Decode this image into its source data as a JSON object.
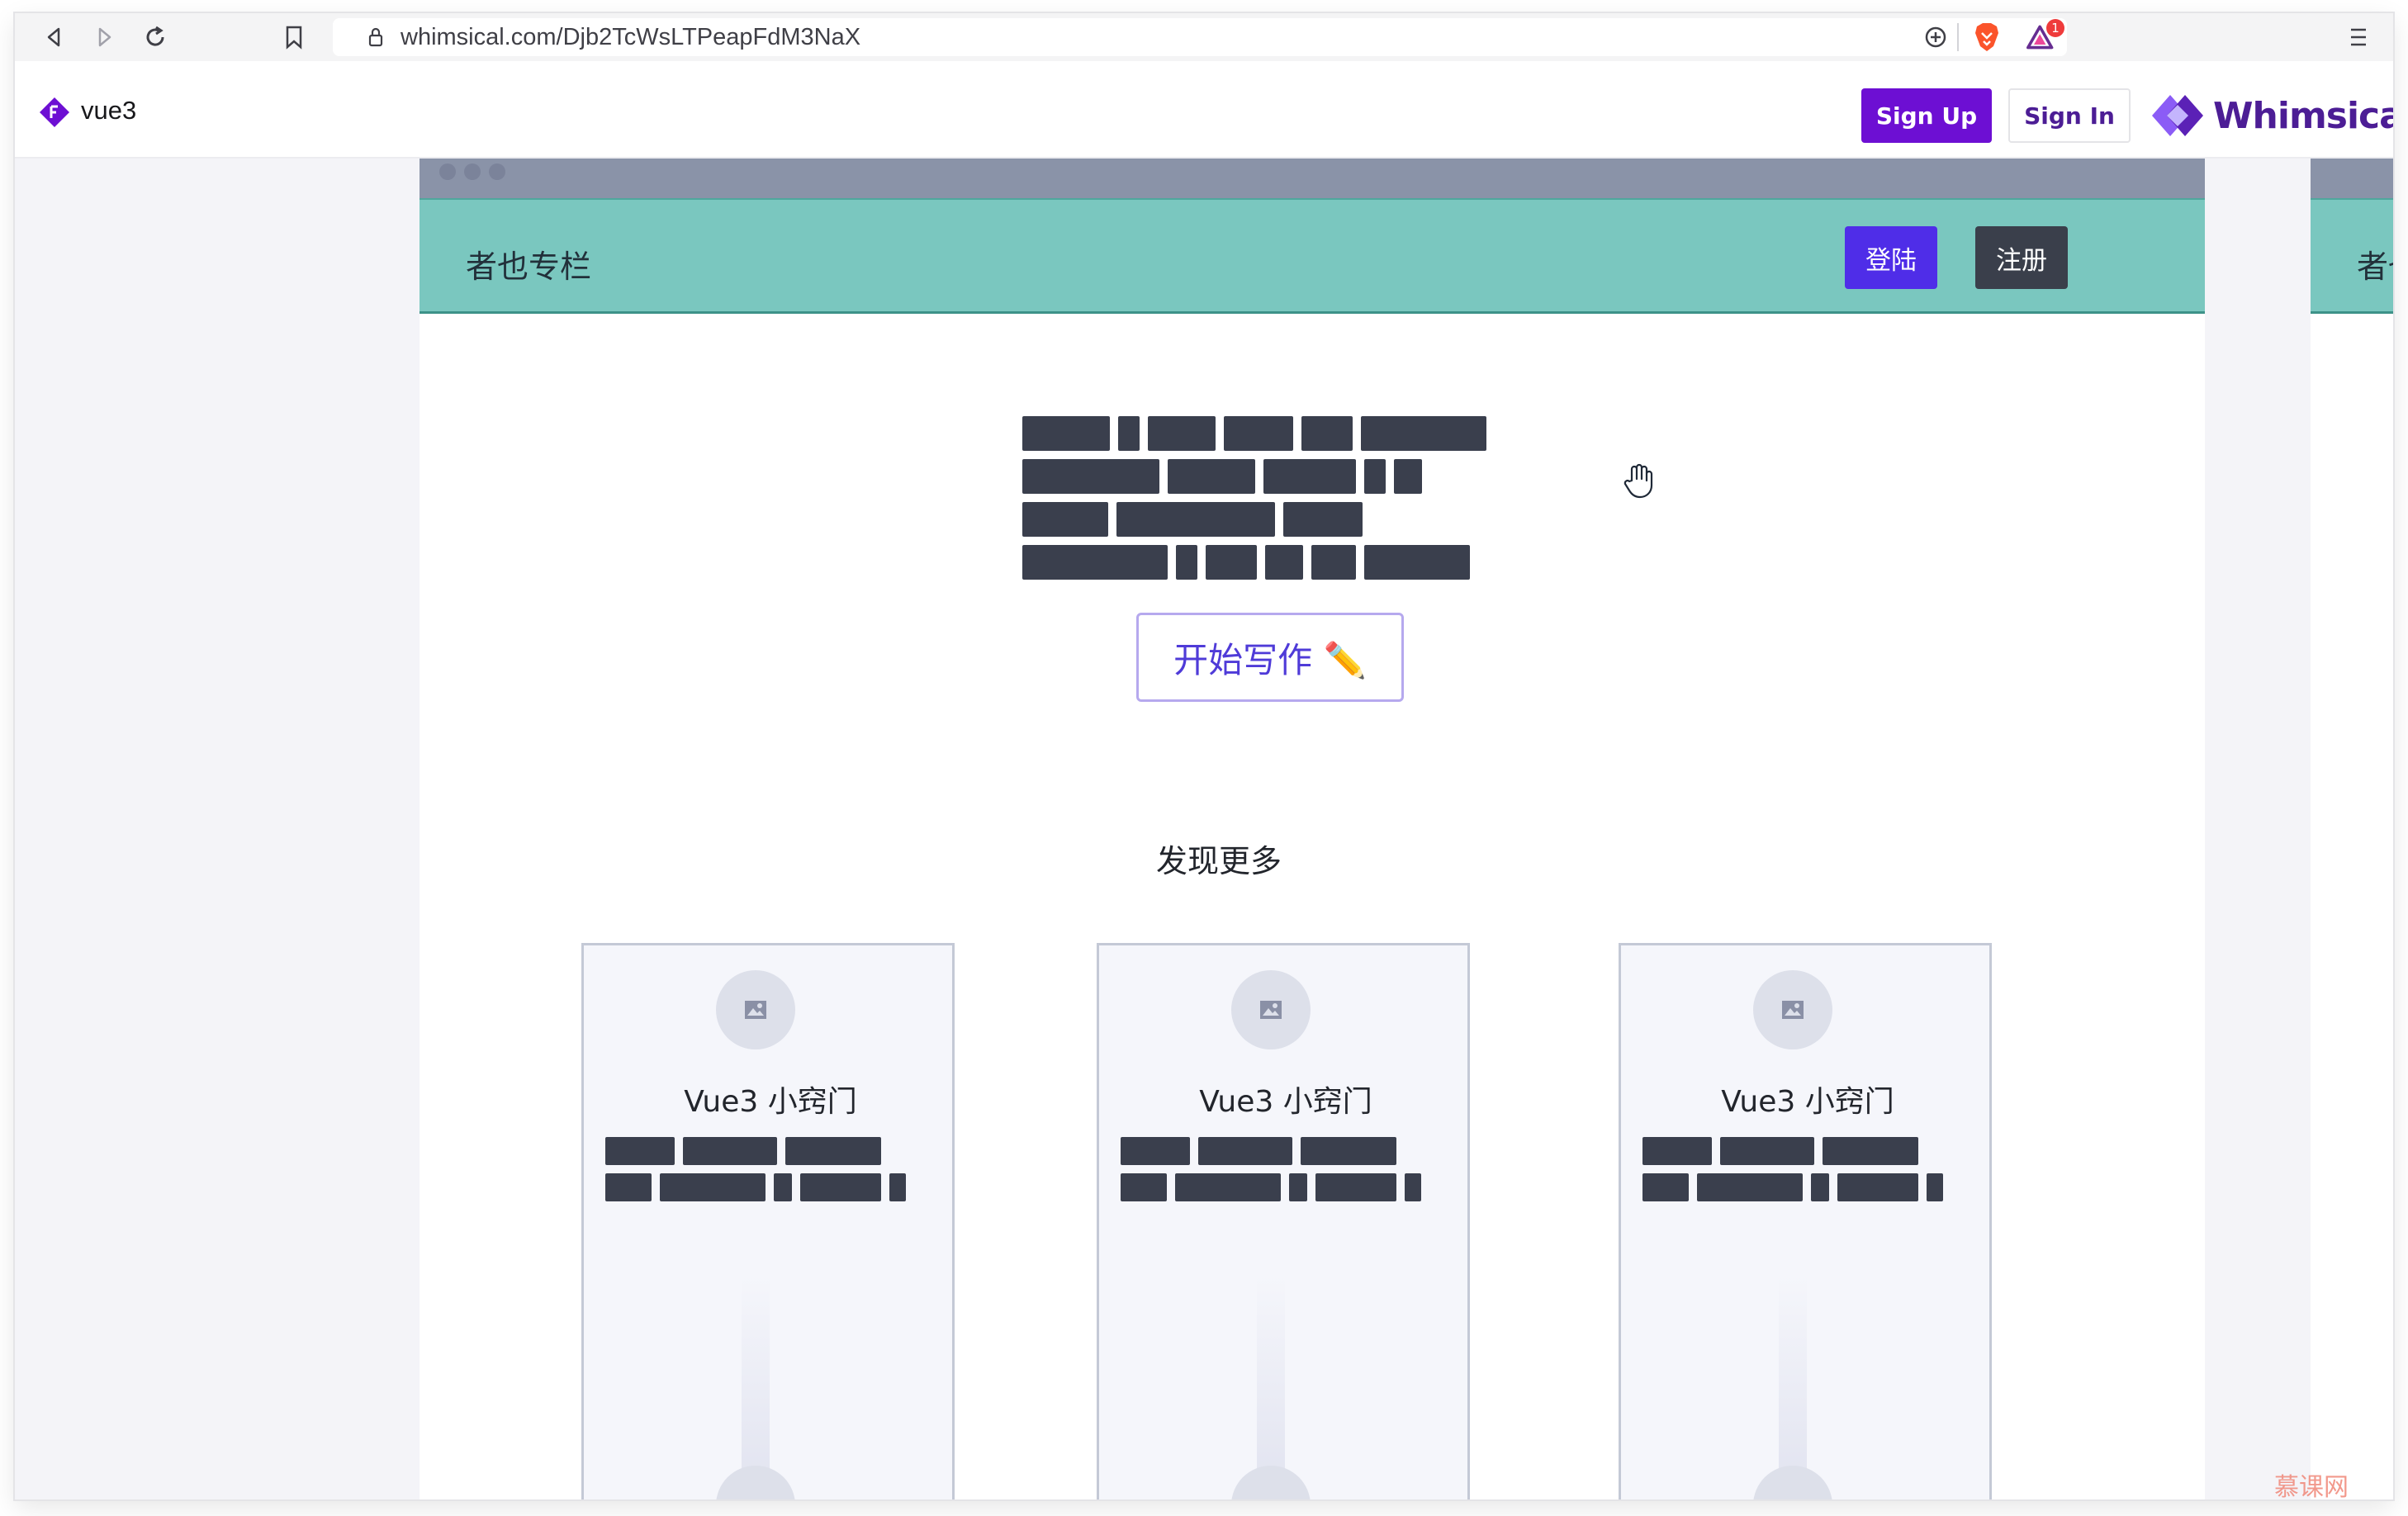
{
  "browser": {
    "url": "whimsical.com/Djb2TcWsLTPeapFdM3NaX",
    "notification_count": "1"
  },
  "header": {
    "doc_title": "vue3",
    "signup_label": "Sign Up",
    "signin_label": "Sign In",
    "brand_name": "Whimsical"
  },
  "wireframe": {
    "site_title": "者也专栏",
    "login_label": "登陆",
    "register_label": "注册",
    "start_writing_label": "开始写作 ✏️",
    "discover_title": "发现更多",
    "cards": [
      {
        "title": "Vue3 小窍门"
      },
      {
        "title": "Vue3 小窍门"
      },
      {
        "title": "Vue3 小窍门"
      }
    ],
    "partial_right_title": "者也"
  },
  "colors": {
    "brand_purple": "#6d0fd3",
    "navbar_teal": "#7ac7bf",
    "login_blue": "#4f2de8",
    "register_dark": "#3a3f4b"
  },
  "watermark": "慕课网"
}
